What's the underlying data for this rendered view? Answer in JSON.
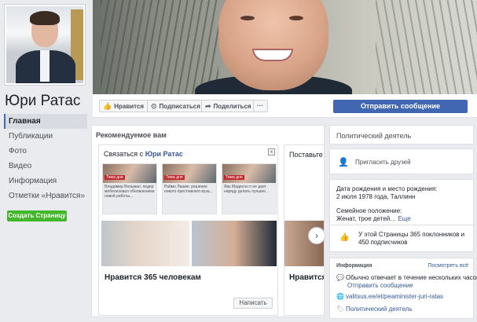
{
  "page": {
    "name": "Юри Ратас",
    "nav": [
      "Главная",
      "Публикации",
      "Фото",
      "Видео",
      "Информация",
      "Отметки «Нравится»"
    ],
    "create_page": "Создать Страницу"
  },
  "actions": {
    "like": "Нравится",
    "subscribe": "Подписаться",
    "share": "Поделиться",
    "more": "···",
    "send_message": "Отправить сообщение"
  },
  "recommended": {
    "title": "Рекомендуемое вам",
    "card1": {
      "heading_prefix": "Связаться с",
      "heading_name": "Юри Ратас",
      "close": "×",
      "thumbs": [
        {
          "tag": "Тема дня",
          "text": "Владимир Вельман: лидер мобилизовал обновлением новой работы..."
        },
        {
          "tag": "Тема дня",
          "text": "Раймо Лааме: решение нового престижного вуза..."
        },
        {
          "tag": "Тема дня",
          "text": "Яак Мадисон о не дает наряду делать лучшее..."
        }
      ],
      "likes": "Нравится 365 человекам",
      "write": "Написать"
    },
    "card2": {
      "heading": "Поставьте э",
      "likes": "Нравится"
    },
    "next_arrow": "›"
  },
  "sidebar": {
    "category": "Политический деятель",
    "invite": "Пригласить друзей",
    "birth_label": "Дата рождения и место рождения:",
    "birth_value": "2 июля 1978 года, Таллинн",
    "family_label": "Семейное положение:",
    "family_value": "Женат, трое детей…",
    "family_more": "Еще",
    "fans": "У этой Страницы 365 поклонников и 450 подписчиков",
    "info_title": "Информация",
    "see_all": "Посмотреть всё",
    "reply": "Обычно отвечает в течение нескольких часов",
    "send_msg": "Отправить сообщение",
    "website": "valitsus.ee/et/peaminister-juri-ratas",
    "category2": "Политический деятель"
  },
  "colors": {
    "brand": "#4267b2",
    "link": "#365899",
    "create": "#42b72a"
  }
}
